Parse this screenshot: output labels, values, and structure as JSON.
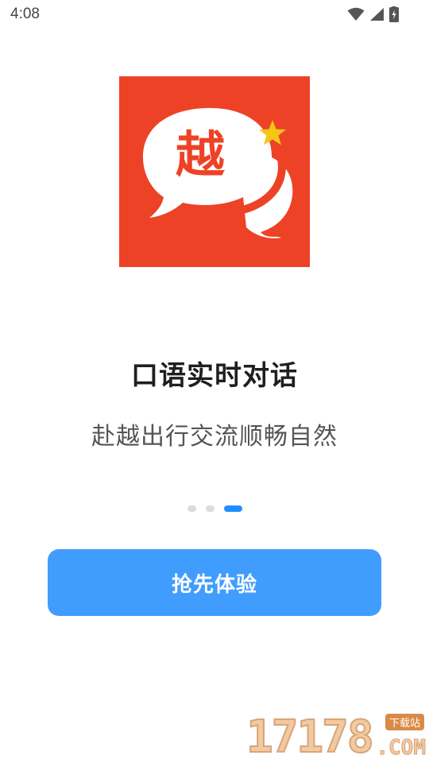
{
  "status_bar": {
    "time": "4:08",
    "icons": [
      "wifi-icon",
      "signal-icon",
      "battery-charging-icon"
    ]
  },
  "logo": {
    "glyph": "越",
    "background_color": "#ee4226",
    "accent_color": "#f5c518"
  },
  "onboarding": {
    "headline": "口语实时对话",
    "subtitle": "赴越出行交流顺畅自然",
    "page_index": 3,
    "page_count": 3
  },
  "cta": {
    "label": "抢先体验",
    "color": "#409dfd"
  },
  "watermark": {
    "digits": "17178",
    "badge": "下载站",
    "domain": ".COM"
  }
}
